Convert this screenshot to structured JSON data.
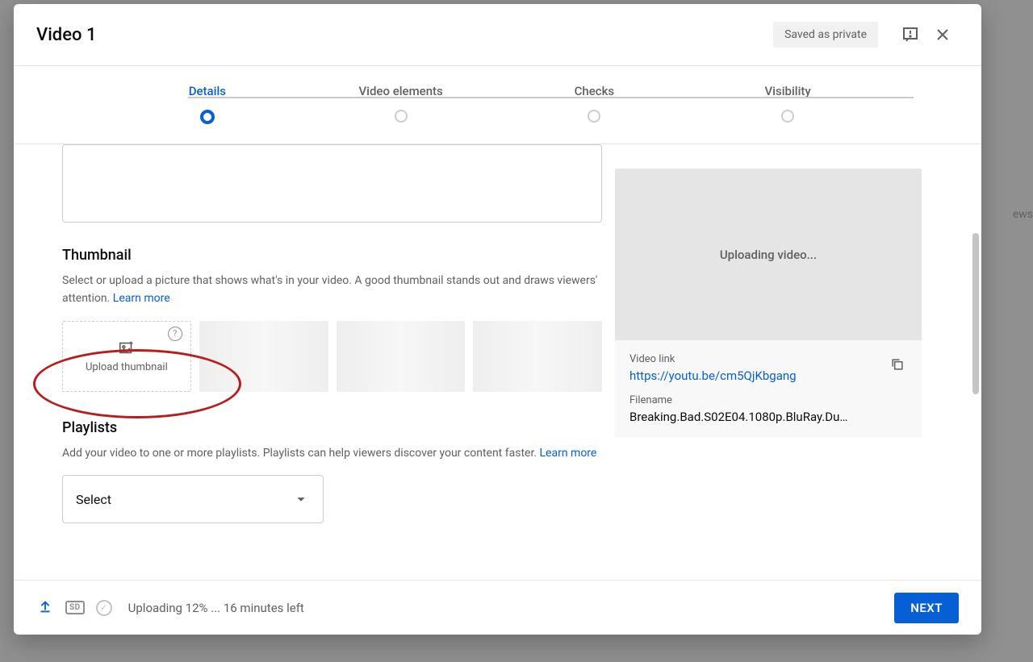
{
  "backdrop": {
    "views_hint": "ews"
  },
  "header": {
    "title": "Video 1",
    "saved_badge": "Saved as private"
  },
  "stepper": {
    "steps": [
      {
        "label": "Details"
      },
      {
        "label": "Video elements"
      },
      {
        "label": "Checks"
      },
      {
        "label": "Visibility"
      }
    ]
  },
  "thumbnail": {
    "title": "Thumbnail",
    "desc": "Select or upload a picture that shows what's in your video. A good thumbnail stands out and draws viewers' attention. ",
    "learn_more": "Learn more",
    "upload_label": "Upload thumbnail",
    "help_symbol": "?"
  },
  "playlists": {
    "title": "Playlists",
    "desc": "Add your video to one or more playlists. Playlists can help viewers discover your content faster. ",
    "learn_more": "Learn more",
    "select_label": "Select"
  },
  "preview": {
    "uploading_text": "Uploading video...",
    "link_label": "Video link",
    "link_value": "https://youtu.be/cm5QjKbgang",
    "filename_label": "Filename",
    "filename_value": "Breaking.Bad.S02E04.1080p.BluRay.Du…"
  },
  "footer": {
    "sd_label": "SD",
    "check_symbol": "✓",
    "status": "Uploading 12% ... 16 minutes left",
    "next_label": "NEXT"
  }
}
